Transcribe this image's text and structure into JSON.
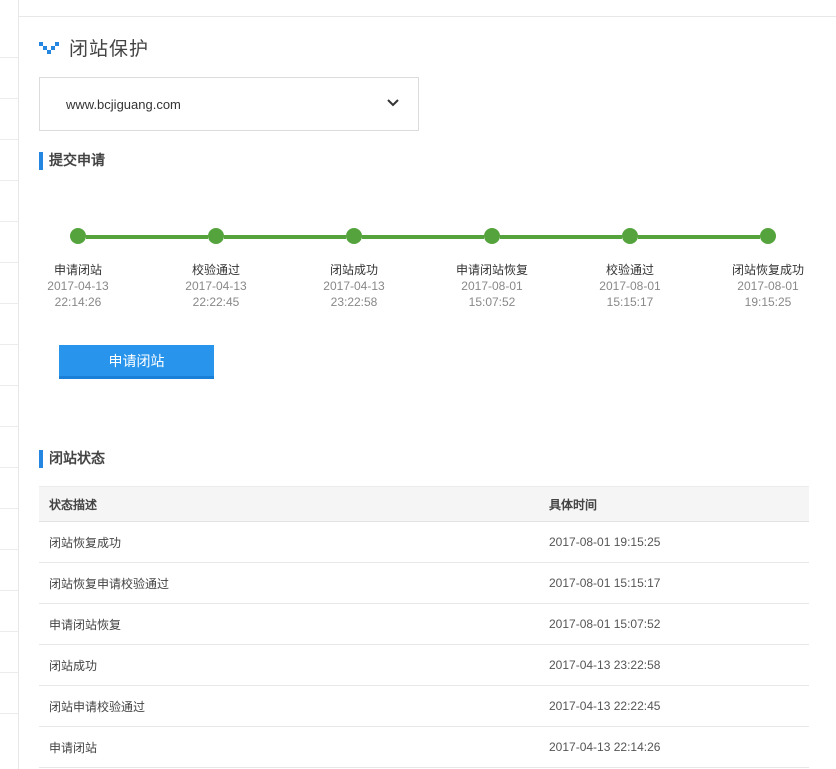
{
  "page": {
    "title": "闭站保护"
  },
  "domain_select": {
    "value": "www.bcjiguang.com"
  },
  "submit_section": {
    "title": "提交申请",
    "steps": [
      {
        "label": "申请闭站",
        "date": "2017-04-13",
        "time": "22:14:26"
      },
      {
        "label": "校验通过",
        "date": "2017-04-13",
        "time": "22:22:45"
      },
      {
        "label": "闭站成功",
        "date": "2017-04-13",
        "time": "23:22:58"
      },
      {
        "label": "申请闭站恢复",
        "date": "2017-08-01",
        "time": "15:07:52"
      },
      {
        "label": "校验通过",
        "date": "2017-08-01",
        "time": "15:15:17"
      },
      {
        "label": "闭站恢复成功",
        "date": "2017-08-01",
        "time": "19:15:25"
      }
    ],
    "apply_button": "申请闭站"
  },
  "status_section": {
    "title": "闭站状态",
    "headers": {
      "desc": "状态描述",
      "time": "具体时间"
    },
    "rows": [
      {
        "desc": "闭站恢复成功",
        "time": "2017-08-01 19:15:25"
      },
      {
        "desc": "闭站恢复申请校验通过",
        "time": "2017-08-01 15:15:17"
      },
      {
        "desc": "申请闭站恢复",
        "time": "2017-08-01 15:07:52"
      },
      {
        "desc": "闭站成功",
        "time": "2017-04-13 23:22:58"
      },
      {
        "desc": "闭站申请校验通过",
        "time": "2017-04-13 22:22:45"
      },
      {
        "desc": "申请闭站",
        "time": "2017-04-13 22:14:26"
      }
    ]
  },
  "colors": {
    "accent": "#2486e0",
    "button": "#2994ec",
    "progress": "#55a33c"
  },
  "icons": {
    "logo": "chevron-logo-icon",
    "dropdown": "chevron-down-icon"
  }
}
